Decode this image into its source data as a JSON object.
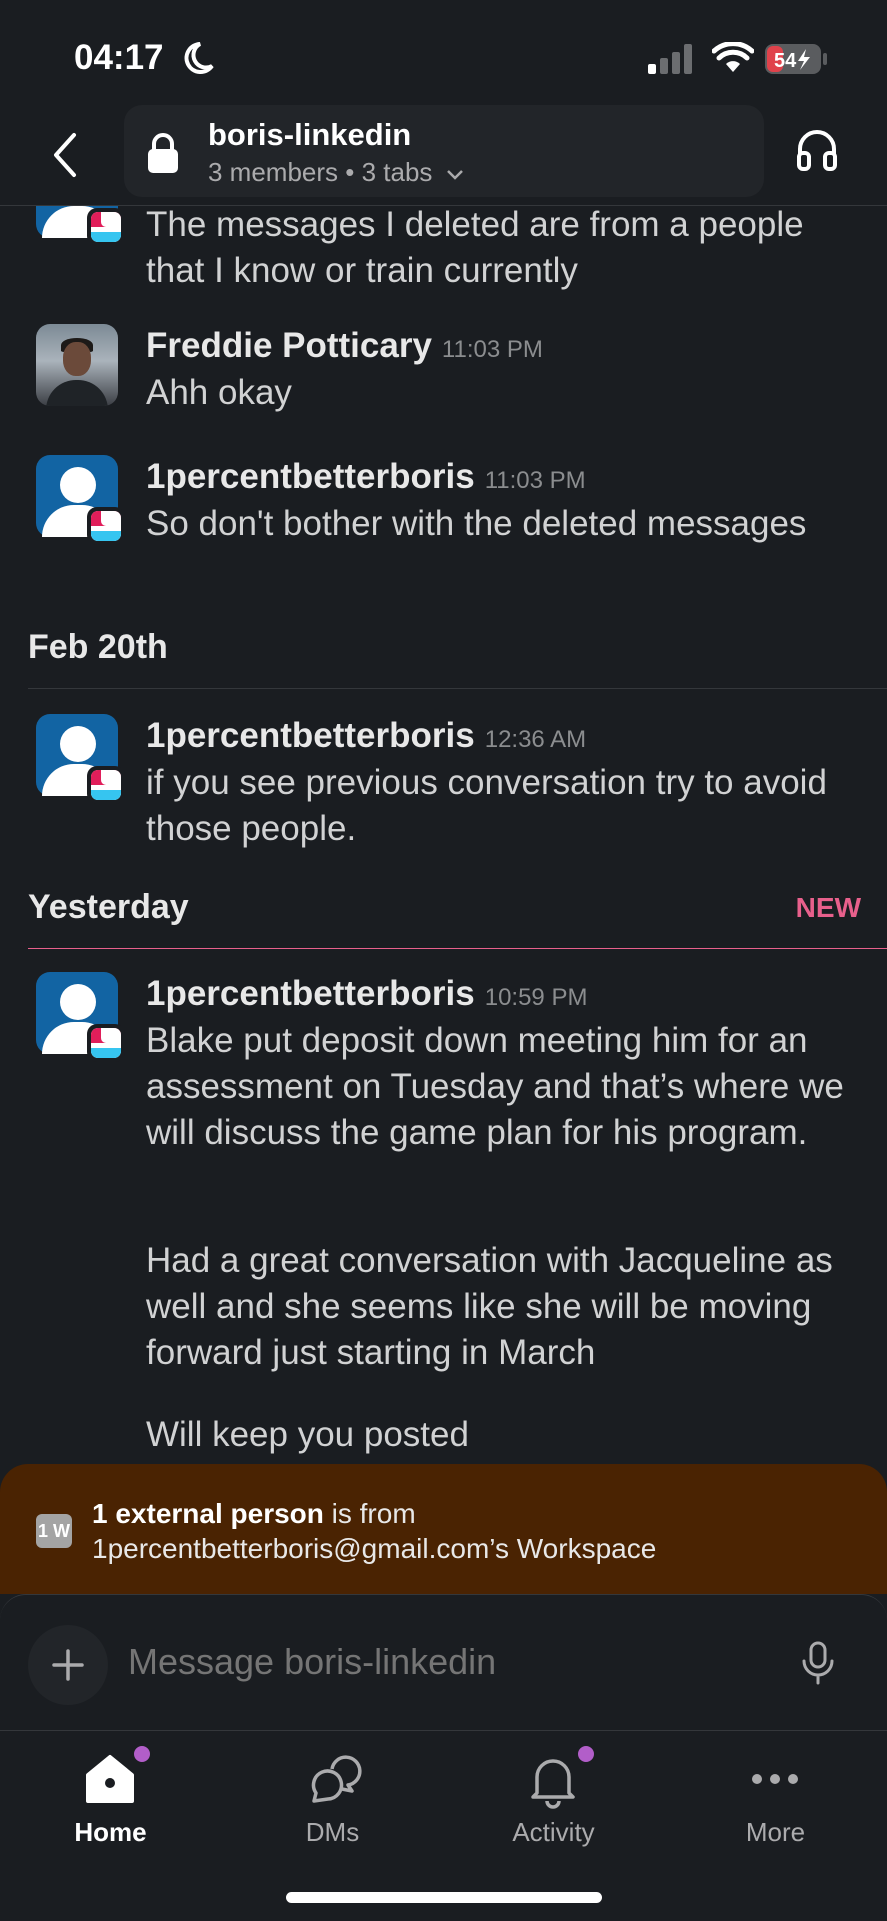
{
  "status_bar": {
    "time": "04:17",
    "battery": "54"
  },
  "header": {
    "channel_name": "boris-linkedin",
    "meta": "3 members • 3 tabs"
  },
  "messages": [
    {
      "text": "The messages I deleted are from a people that I know or train currently"
    },
    {
      "author": "Freddie Potticary",
      "time": "11:03 PM",
      "text": "Ahh okay"
    },
    {
      "author": "1percentbetterboris",
      "time": "11:03 PM",
      "text": "So don't bother with the deleted messages"
    },
    {
      "author": "1percentbetterboris",
      "time": "12:36 AM",
      "text": "if you see previous conversation try to avoid those people."
    },
    {
      "author": "1percentbetterboris",
      "time": "10:59 PM",
      "paragraphs": [
        "Blake put deposit down meeting him for an assessment on Tuesday and that’s where we will discuss the game plan for his program.",
        "Had a great conversation with Jacqueline as well and she seems like she will be moving forward just starting in March",
        "Will keep you posted"
      ]
    }
  ],
  "dividers": {
    "feb20": "Feb 20th",
    "yesterday": "Yesterday",
    "new": "NEW"
  },
  "external_banner": {
    "badge": "1 W",
    "bold": "1 external person",
    "rest": " is from",
    "line2": "1percentbetterboris@gmail.com’s Workspace"
  },
  "composer": {
    "placeholder": "Message boris-linkedin"
  },
  "tabs": [
    {
      "label": "Home",
      "icon": "home-icon"
    },
    {
      "label": "DMs",
      "icon": "dms-icon"
    },
    {
      "label": "Activity",
      "icon": "bell-icon"
    },
    {
      "label": "More",
      "icon": "more-icon"
    }
  ]
}
